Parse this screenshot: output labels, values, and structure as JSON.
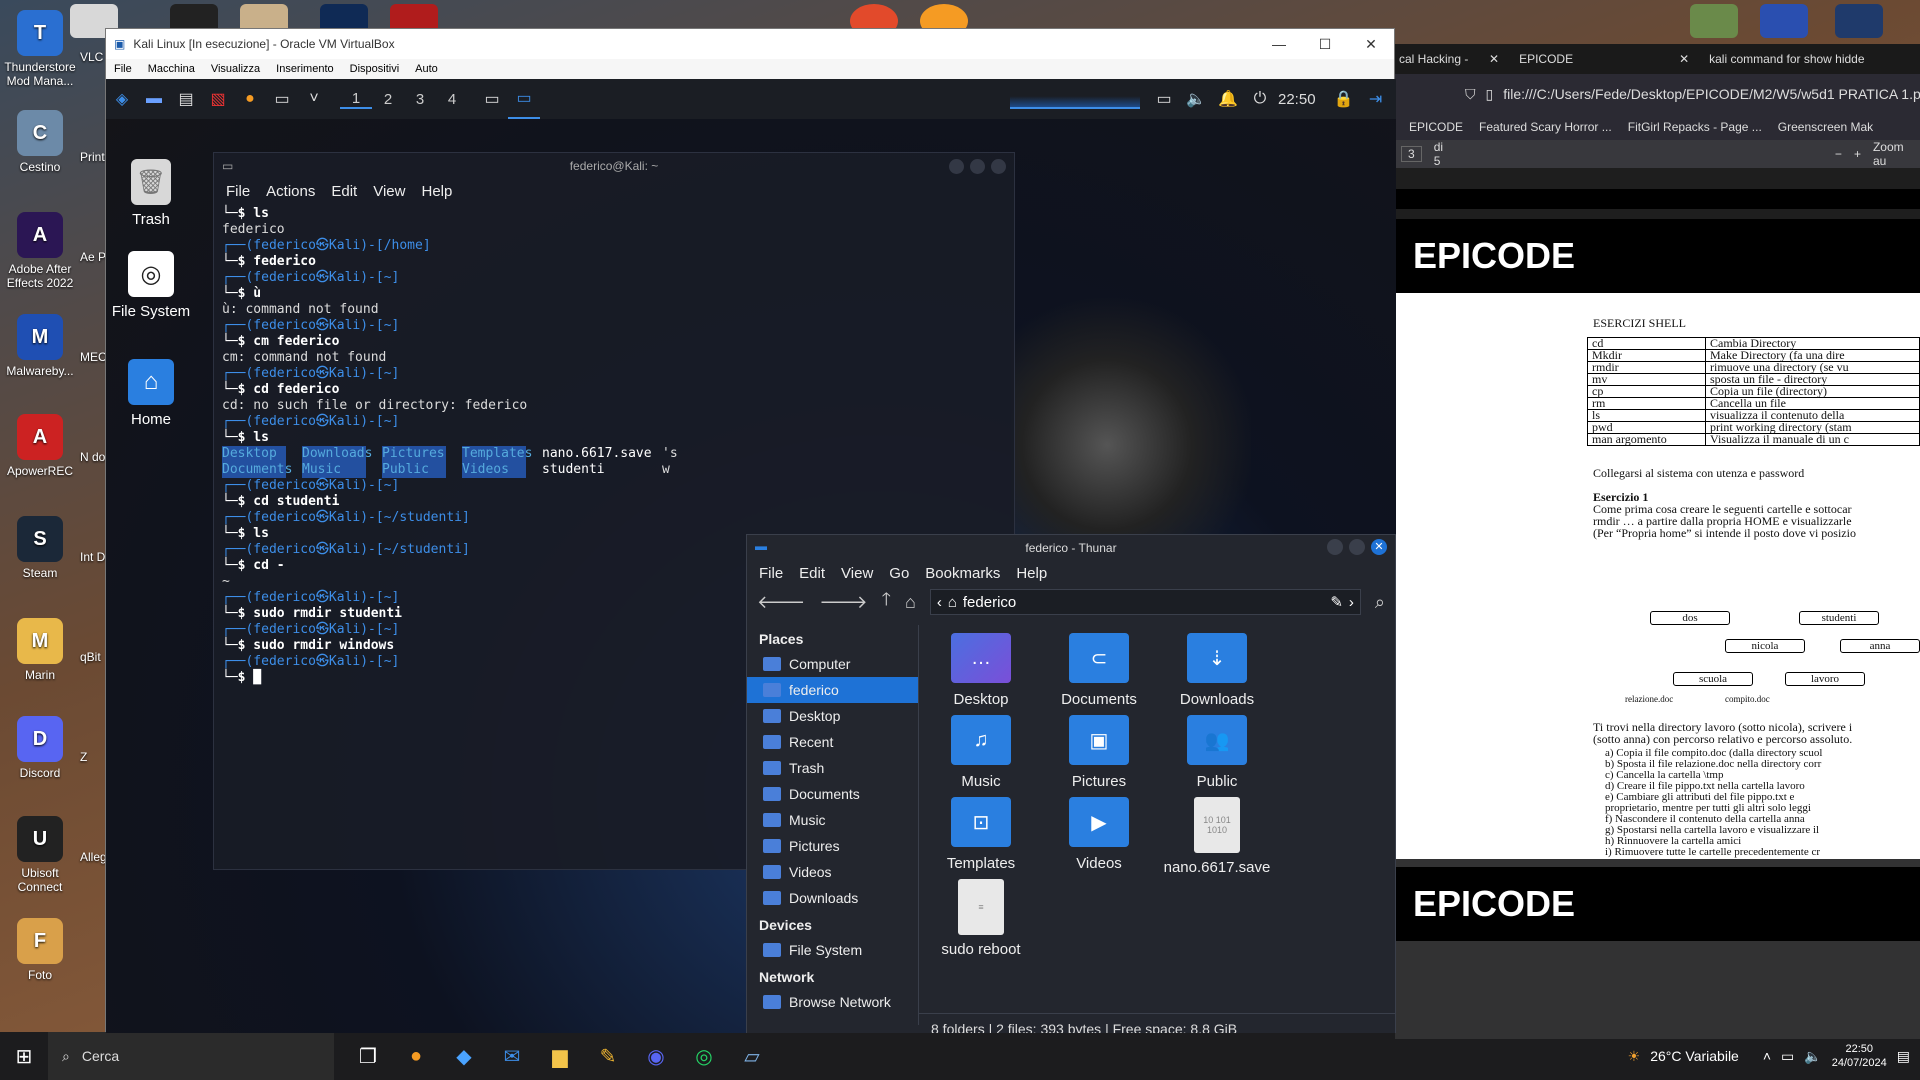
{
  "windows_desktop": {
    "icons": [
      {
        "label": "Thunderstore Mod Mana...",
        "color": "#2a6fd1"
      },
      {
        "label": "Cestino",
        "color": "#6c8aa8"
      },
      {
        "label": "Adobe After Effects 2022",
        "color": "#2b1654"
      },
      {
        "label": "Malwareby...",
        "color": "#1f4fb3"
      },
      {
        "label": "ApowerREC",
        "color": "#cc2222"
      },
      {
        "label": "Steam",
        "color": "#1b2838"
      },
      {
        "label": "Marin",
        "color": "#e8b84a"
      },
      {
        "label": "Discord",
        "color": "#5865f2"
      },
      {
        "label": "Ubisoft Connect",
        "color": "#222"
      },
      {
        "label": "Foto",
        "color": "#d9a04a"
      }
    ],
    "col2_labels": [
      "VLC",
      "Print",
      "Ae Pren",
      "MEC",
      "N doc",
      "Int Do",
      "qBit",
      "Z",
      "Alleg"
    ]
  },
  "taskbar": {
    "search_placeholder": "Cerca",
    "weather": "26°C  Variabile",
    "time": "22:50",
    "date": "24/07/2024"
  },
  "virtualbox": {
    "title": "Kali Linux [In esecuzione] - Oracle VM VirtualBox",
    "menu": [
      "File",
      "Macchina",
      "Visualizza",
      "Inserimento",
      "Dispositivi",
      "Auto"
    ]
  },
  "kali": {
    "panel": {
      "workspaces": [
        "1",
        "2",
        "3",
        "4"
      ],
      "clock": "22:50"
    },
    "desktop_icons": [
      "Trash",
      "File System",
      "Home"
    ],
    "terminal": {
      "title": "federico@Kali: ~",
      "menu": [
        "File",
        "Actions",
        "Edit",
        "View",
        "Help"
      ],
      "lines": [
        {
          "p": "",
          "t": "└─$ ls"
        },
        {
          "p": "",
          "t": "federico"
        },
        {
          "p": "",
          "t": ""
        },
        {
          "p": "┌──(federico㉿Kali)-[/home]",
          "t": ""
        },
        {
          "p": "",
          "t": "└─$ federico"
        },
        {
          "p": "",
          "t": ""
        },
        {
          "p": "┌──(federico㉿Kali)-[~]",
          "t": ""
        },
        {
          "p": "",
          "t": "└─$ ù"
        },
        {
          "p": "",
          "t": "ù: command not found"
        },
        {
          "p": "",
          "t": ""
        },
        {
          "p": "┌──(federico㉿Kali)-[~]",
          "t": ""
        },
        {
          "p": "",
          "t": "└─$ cm federico"
        },
        {
          "p": "",
          "t": "cm: command not found"
        },
        {
          "p": "",
          "t": ""
        },
        {
          "p": "┌──(federico㉿Kali)-[~]",
          "t": ""
        },
        {
          "p": "",
          "t": "└─$ cd federico"
        },
        {
          "p": "",
          "t": "cd: no such file or directory: federico"
        },
        {
          "p": "",
          "t": ""
        },
        {
          "p": "┌──(federico㉿Kali)-[~]",
          "t": ""
        },
        {
          "p": "",
          "t": "└─$ ls"
        }
      ],
      "ls_row1": [
        "Desktop",
        "Downloads",
        "Pictures",
        "Templates",
        "nano.6617.save",
        "'s"
      ],
      "ls_row2": [
        "Documents",
        "Music",
        "Public",
        "Videos",
        "studenti",
        "w"
      ],
      "lines2": [
        {
          "p": "",
          "t": ""
        },
        {
          "p": "┌──(federico㉿Kali)-[~]",
          "t": ""
        },
        {
          "p": "",
          "t": "└─$ cd studenti"
        },
        {
          "p": "",
          "t": ""
        },
        {
          "p": "┌──(federico㉿Kali)-[~/studenti]",
          "t": ""
        },
        {
          "p": "",
          "t": "└─$ ls"
        },
        {
          "p": "",
          "t": ""
        },
        {
          "p": "┌──(federico㉿Kali)-[~/studenti]",
          "t": ""
        },
        {
          "p": "",
          "t": "└─$ cd -"
        },
        {
          "p": "",
          "t": "~"
        },
        {
          "p": "",
          "t": ""
        },
        {
          "p": "┌──(federico㉿Kali)-[~]",
          "t": ""
        },
        {
          "p": "",
          "t": "└─$ sudo rmdir studenti"
        },
        {
          "p": "",
          "t": ""
        },
        {
          "p": "┌──(federico㉿Kali)-[~]",
          "t": ""
        },
        {
          "p": "",
          "t": "└─$ sudo rmdir windows"
        },
        {
          "p": "",
          "t": ""
        },
        {
          "p": "┌──(federico㉿Kali)-[~]",
          "t": ""
        },
        {
          "p": "",
          "t": "└─$ █"
        }
      ]
    },
    "thunar": {
      "title": "federico - Thunar",
      "menu": [
        "File",
        "Edit",
        "View",
        "Go",
        "Bookmarks",
        "Help"
      ],
      "path": "federico",
      "places_header": "Places",
      "places": [
        "Computer",
        "federico",
        "Desktop",
        "Recent",
        "Trash",
        "Documents",
        "Music",
        "Pictures",
        "Videos",
        "Downloads"
      ],
      "devices_header": "Devices",
      "devices": [
        "File System"
      ],
      "network_header": "Network",
      "network": [
        "Browse Network"
      ],
      "files": [
        {
          "name": "Desktop",
          "icon": "…"
        },
        {
          "name": "Documents",
          "icon": "⊂"
        },
        {
          "name": "Downloads",
          "icon": "⇣"
        },
        {
          "name": "Music",
          "icon": "♫"
        },
        {
          "name": "Pictures",
          "icon": "▣"
        },
        {
          "name": "Public",
          "icon": "👥"
        },
        {
          "name": "Templates",
          "icon": "⊡"
        },
        {
          "name": "Videos",
          "icon": "▶"
        },
        {
          "name": "nano.6617.save",
          "icon": "10 101 1010"
        },
        {
          "name": "sudo reboot",
          "icon": "≡"
        }
      ],
      "status": "8 folders  |  2 files: 393 bytes  |  Free space: 8.8 GiB"
    }
  },
  "browser": {
    "tabs": [
      "cal Hacking - N",
      "EPICODE",
      "kali command for show hidde"
    ],
    "url": "file:///C:/Users/Fede/Desktop/EPICODE/M2/W5/w5d1 PRATICA 1.p",
    "bookmarks": [
      "EPICODE",
      "Featured Scary Horror ...",
      "FitGirl Repacks - Page ...",
      "Greenscreen Mak"
    ],
    "pdf_page": "3",
    "pdf_of": "di 5",
    "pdf_zoom": "Zoom au",
    "doc": {
      "logo": "EPICODE",
      "heading": "ESERCIZI SHELL",
      "commands": [
        [
          "cd",
          "Cambia Directory"
        ],
        [
          "Mkdir",
          "Make Directory (fa una dire"
        ],
        [
          "rmdir",
          "rimuove una directory (se vu"
        ],
        [
          "mv",
          "sposta un file - directory"
        ],
        [
          "cp",
          "Copia un file (directory)"
        ],
        [
          "rm",
          "Cancella un file"
        ],
        [
          "ls",
          "visualizza il contenuto della"
        ],
        [
          "pwd",
          "print working directory (stam"
        ],
        [
          "man argomento",
          "Visualizza il manuale di un c"
        ]
      ],
      "p1": "Collegarsi al sistema con utenza e password",
      "ex_title": "Esercizio 1",
      "ex_text": [
        "Come prima cosa creare le seguenti cartelle e sottocar",
        "rmdir … a partire dalla propria HOME e visualizzarle",
        "(Per “Propria home” si intende il posto dove vi posizio"
      ],
      "tree": [
        "dos",
        "studenti",
        "nicola",
        "anna",
        "scuola",
        "lavoro",
        "relazione.doc",
        "compito.doc"
      ],
      "p2": [
        "Ti trovi nella directory lavoro (sotto nicola), scrivere i",
        "(sotto anna) con percorso relativo e percorso assoluto."
      ],
      "steps": [
        "a)  Copia il file compito.doc (dalla directory scuol",
        "b)  Sposta il file relazione.doc nella directory corr",
        "c)  Cancella la cartella \\tmp",
        "d)  Creare il file pippo.txt nella cartella lavoro",
        "e)  Cambiare gli attributi del file pippo.txt e",
        "      proprietario, mentre per tutti gli altri solo leggi",
        "f)   Nascondere il contenuto della cartella anna",
        "g)  Spostarsi nella cartella lavoro e visualizzare il",
        "h)  Rinnuovere la cartella amici",
        "i)   Rimuovere tutte le cartelle precedentemente cr"
      ]
    }
  }
}
